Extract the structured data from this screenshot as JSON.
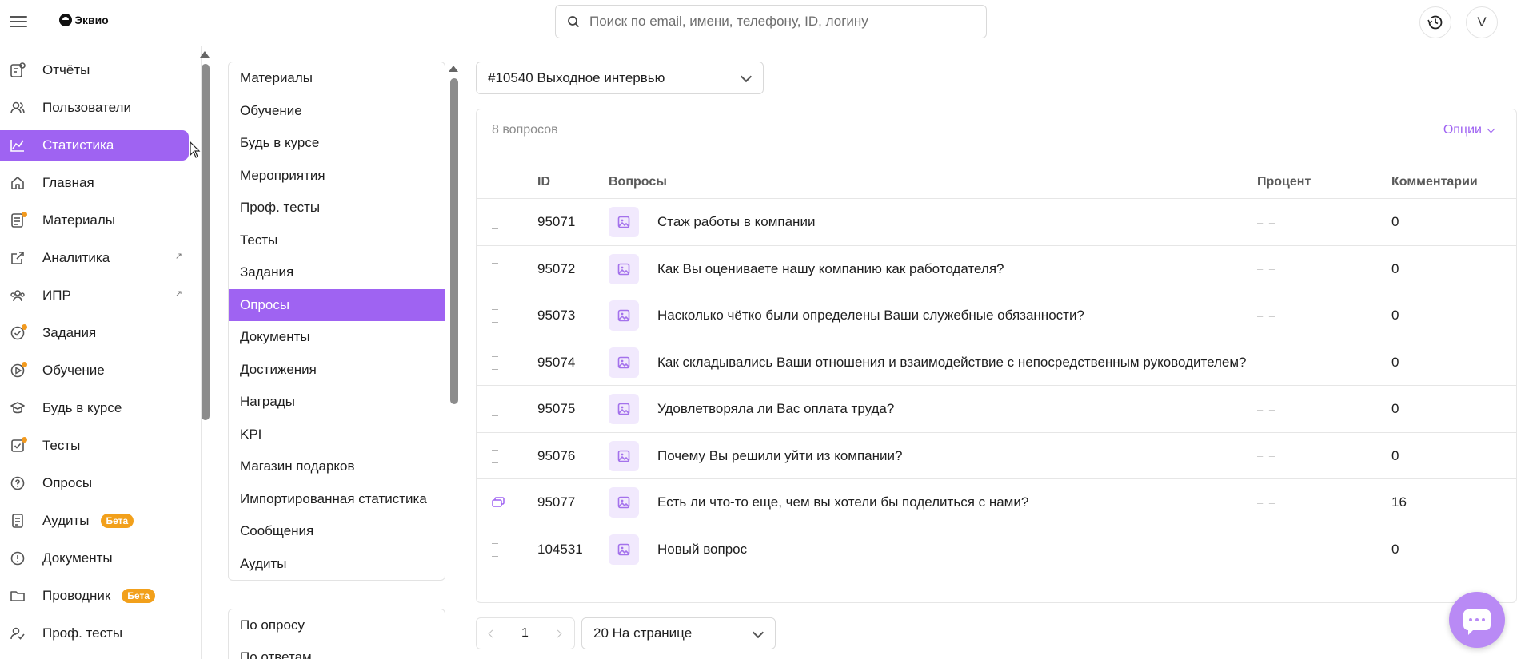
{
  "app": {
    "logo_text": "Эквио"
  },
  "search": {
    "placeholder": "Поиск по email, имени, телефону, ID, логину"
  },
  "user": {
    "avatar_letter": "V"
  },
  "sidebar": {
    "items": [
      {
        "label": "Отчёты",
        "icon": "reports-icon"
      },
      {
        "label": "Пользователи",
        "icon": "users-icon"
      },
      {
        "label": "Статистика",
        "icon": "statistics-icon",
        "active": true
      },
      {
        "label": "Главная",
        "icon": "home-icon"
      },
      {
        "label": "Материалы",
        "icon": "materials-icon",
        "dot": true
      },
      {
        "label": "Аналитика",
        "icon": "analytics-icon",
        "external": true
      },
      {
        "label": "ИПР",
        "icon": "ipr-icon",
        "external": true
      },
      {
        "label": "Задания",
        "icon": "tasks-icon",
        "dot": true
      },
      {
        "label": "Обучение",
        "icon": "learning-icon",
        "dot": true
      },
      {
        "label": "Будь в курсе",
        "icon": "news-icon"
      },
      {
        "label": "Тесты",
        "icon": "tests-icon",
        "dot": true
      },
      {
        "label": "Опросы",
        "icon": "surveys-icon"
      },
      {
        "label": "Аудиты",
        "icon": "audits-icon",
        "badge": "Бета"
      },
      {
        "label": "Документы",
        "icon": "documents-icon"
      },
      {
        "label": "Проводник",
        "icon": "explorer-icon",
        "badge": "Бета"
      },
      {
        "label": "Проф. тесты",
        "icon": "prof-tests-icon"
      }
    ]
  },
  "categories": {
    "items": [
      "Материалы",
      "Обучение",
      "Будь в курсе",
      "Мероприятия",
      "Проф. тесты",
      "Тесты",
      "Задания",
      "Опросы",
      "Документы",
      "Достижения",
      "Награды",
      "KPI",
      "Магазин подарков",
      "Импортированная статистика",
      "Сообщения",
      "Аудиты"
    ],
    "active_index": 7
  },
  "subcategories": {
    "items": [
      "По опросу",
      "По ответам"
    ]
  },
  "survey_select": {
    "value": "#10540 Выходное интервью"
  },
  "table": {
    "count_label": "8 вопросов",
    "options_label": "Опции",
    "headers": {
      "id": "ID",
      "question": "Вопросы",
      "percent": "Процент",
      "comments": "Комментарии"
    },
    "rows": [
      {
        "id": "95071",
        "question": "Стаж работы в компании",
        "percent": "– –",
        "comments": "0"
      },
      {
        "id": "95072",
        "question": "Как Вы оцениваете нашу компанию как работодателя?",
        "percent": "– –",
        "comments": "0"
      },
      {
        "id": "95073",
        "question": "Насколько чётко были определены Ваши служебные обязанности?",
        "percent": "– –",
        "comments": "0"
      },
      {
        "id": "95074",
        "question": "Как складывались Ваши отношения и взаимодействие с непосредственным руководителем?",
        "percent": "– –",
        "comments": "0"
      },
      {
        "id": "95075",
        "question": "Удовлетворяла ли Вас оплата труда?",
        "percent": "– –",
        "comments": "0"
      },
      {
        "id": "95076",
        "question": "Почему Вы решили уйти из компании?",
        "percent": "– –",
        "comments": "0"
      },
      {
        "id": "95077",
        "question": "Есть ли что-то еще, чем вы хотели бы поделиться с нами?",
        "percent": "– –",
        "comments": "16",
        "has_comments_icon": true
      },
      {
        "id": "104531",
        "question": "Новый вопрос",
        "percent": "– –",
        "comments": "0"
      }
    ]
  },
  "pagination": {
    "current_page": "1",
    "per_page": "20 На странице"
  },
  "colors": {
    "accent": "#9f63f2",
    "badge": "#f2a01b",
    "chat": "#b98af5"
  }
}
